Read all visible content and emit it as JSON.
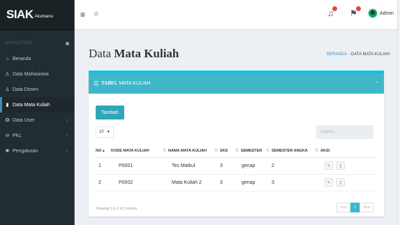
{
  "brand": {
    "logo": "SIAK",
    "sub": "Akuntansi"
  },
  "sidebar": {
    "header": "NAVIGATION",
    "items": [
      {
        "label": "Beranda",
        "icon": "home-icon",
        "glyph": "⌂"
      },
      {
        "label": "Data Mahasiswa",
        "icon": "user-icon",
        "glyph": "♙"
      },
      {
        "label": "Data Dosen",
        "icon": "user-icon",
        "glyph": "♙"
      },
      {
        "label": "Data Mata Kuliah",
        "icon": "book-icon",
        "glyph": "▮"
      },
      {
        "label": "Data User",
        "icon": "user-settings-icon",
        "glyph": "✪"
      },
      {
        "label": "PKL",
        "icon": "folder-icon",
        "glyph": "⊖"
      },
      {
        "label": "Pengaturan",
        "icon": "gear-icon",
        "glyph": "✺"
      }
    ]
  },
  "topbar": {
    "menu_glyph": "≡",
    "home_glyph": "⌂",
    "bell_glyph": "♫",
    "flag_glyph": "⚑",
    "user": "Admin"
  },
  "page": {
    "title_plain": "Data",
    "title_bold": "Mata Kuliah",
    "breadcrumb": {
      "home": "BERANDA",
      "current": "DATA MATA KULIAH"
    }
  },
  "box": {
    "title_bold": "TABEL",
    "title_rest": "MATA KULIAH",
    "collapse_glyph": "−",
    "add_button": "Tambah",
    "page_length": "10",
    "search_placeholder": "Search...",
    "columns": [
      "NO",
      "KODE MATA KULIAH",
      "NAMA MATA KULIAH",
      "SKS",
      "SEMESTER",
      "SEMESTER ANGKA",
      "AKSI"
    ],
    "rows": [
      {
        "no": "1",
        "kode": "P0001",
        "nama": "Tes Matkul",
        "sks": "3",
        "semester": "genap",
        "angka": "2"
      },
      {
        "no": "2",
        "kode": "P0002",
        "nama": "Mata Kuliah 2",
        "sks": "3",
        "semester": "genap",
        "angka": "3"
      }
    ],
    "info": "Showing 1 to 2 of 2 entries",
    "pager": {
      "prev": "Prev",
      "current": "1",
      "next": "Next"
    }
  },
  "colors": {
    "accent": "#3fb7c9",
    "sidebar": "#222d32",
    "active_border": "#3c8dbc"
  }
}
